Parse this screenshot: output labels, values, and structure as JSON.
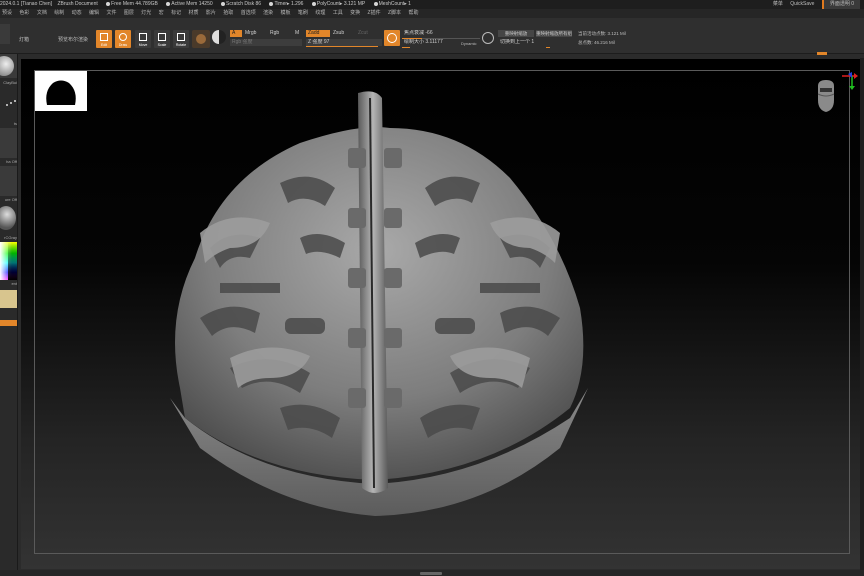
{
  "titlebar": {
    "app": "2024.0.1 [Tianao Chen]",
    "document": "ZBrush Document",
    "free_mem": "Free Mem 44.789GB",
    "active_mem": "Active Mem 14250",
    "scratch_disk": "Scratch Disk 86",
    "timer": "Timer▸ 1.296",
    "polycount": "PolyCount▸ 3.121 MP",
    "meshcount": "MeshCount▸ 1",
    "menu_label": "菜单",
    "quicksave": "QuickSave",
    "transparency": "界面透明 0"
  },
  "menubar": {
    "items": [
      "预设",
      "色彩",
      "文档",
      "绘制",
      "动态",
      "编辑",
      "文件",
      "图层",
      "灯光",
      "宏",
      "标记",
      "材质",
      "影片",
      "拾取",
      "首选项",
      "渲染",
      "模板",
      "笔刷",
      "纹理",
      "工具",
      "变换",
      "Z插件",
      "Z脚本",
      "帮助"
    ]
  },
  "toolbar": {
    "lightbox": "灯箱",
    "preview_render": "预览布尔渲染",
    "btn_edit": "Edit",
    "btn_draw": "Draw",
    "btn_move": "Move",
    "btn_scale": "Scale",
    "btn_rotate": "Rotate",
    "a_label": "A",
    "mrgb": "Mrgb",
    "rgb": "Rgb",
    "m": "M",
    "zadd": "Zadd",
    "zsub": "Zsub",
    "zcut": "Zcut",
    "rgb_intensity": "Rgb 强度",
    "z_intensity": "Z 强度 97",
    "focal_shift": "焦点衰减 -66",
    "draw_size": "绘制大小 3.11177",
    "dynamic": "Dynamic",
    "scale_master": "重映射缩放",
    "scale_master_all": "重映射缩放所有组",
    "subtool_points": "当前活动点数: 3.121 Mil",
    "subtool_count": "切换到上一个 1",
    "total_points": "总点数: 46.216 Mil"
  },
  "leftpanel": {
    "brush_label": "ClayBui",
    "stroke_label": "ts",
    "alpha_label": "ha Off",
    "texture_label": "ure Off",
    "material_label": "rCGray",
    "gradient_label": "ent"
  },
  "colors": {
    "accent": "#e2862a",
    "background": "#2b2b2b",
    "canvas_top": "#000000",
    "canvas_bottom": "#333333"
  }
}
